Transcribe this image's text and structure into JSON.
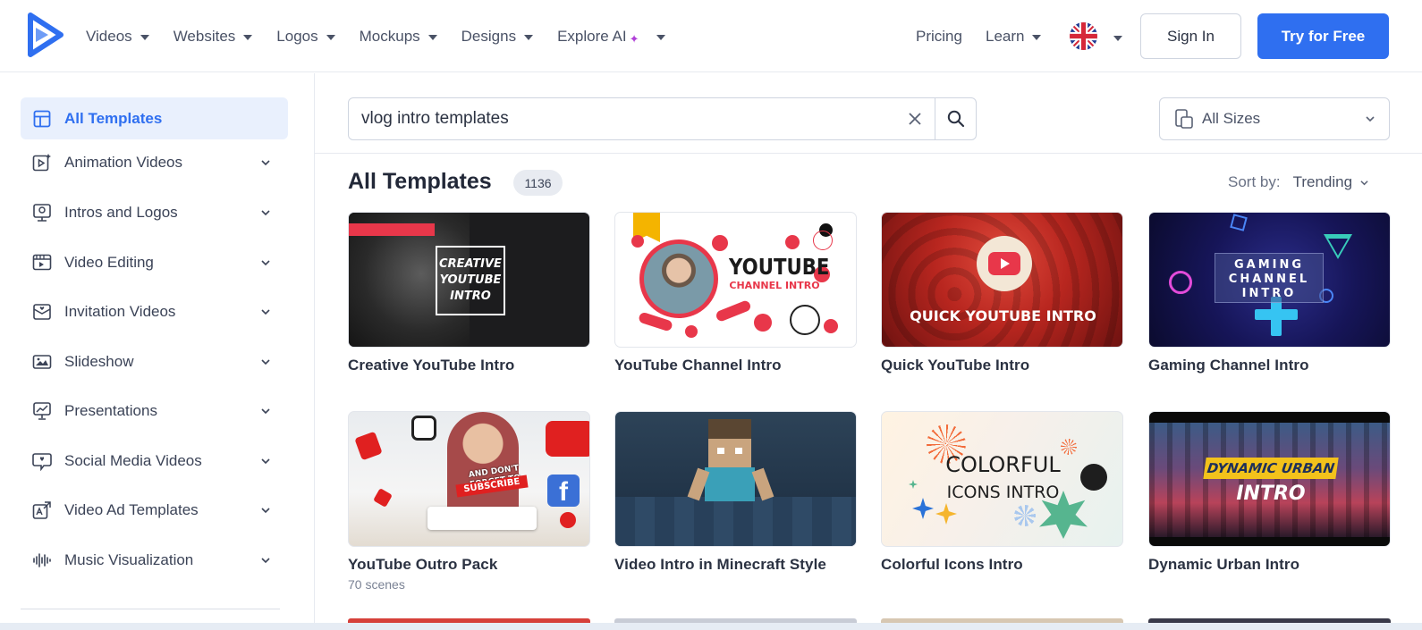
{
  "header": {
    "nav": [
      {
        "label": "Videos"
      },
      {
        "label": "Websites"
      },
      {
        "label": "Logos"
      },
      {
        "label": "Mockups"
      },
      {
        "label": "Designs"
      },
      {
        "label": "Explore AI"
      }
    ],
    "pricing": "Pricing",
    "learn": "Learn",
    "sign_in": "Sign In",
    "try_free": "Try for Free"
  },
  "sidebar": {
    "items": [
      {
        "label": "All Templates",
        "icon": "grid-layout-icon",
        "active": true
      },
      {
        "label": "Animation Videos",
        "icon": "play-sparkle-icon"
      },
      {
        "label": "Intros and Logos",
        "icon": "intro-monitor-icon"
      },
      {
        "label": "Video Editing",
        "icon": "film-edit-icon"
      },
      {
        "label": "Invitation Videos",
        "icon": "invitation-icon"
      },
      {
        "label": "Slideshow",
        "icon": "slideshow-icon"
      },
      {
        "label": "Presentations",
        "icon": "presentation-icon"
      },
      {
        "label": "Social Media Videos",
        "icon": "social-heart-icon"
      },
      {
        "label": "Video Ad Templates",
        "icon": "ad-icon"
      },
      {
        "label": "Music Visualization",
        "icon": "waveform-icon"
      }
    ]
  },
  "search": {
    "value": "vlog intro templates"
  },
  "sizes": {
    "label": "All Sizes"
  },
  "main": {
    "title": "All Templates",
    "count": "1136",
    "sort_label": "Sort by:",
    "sort_value": "Trending"
  },
  "cards": [
    {
      "title": "Creative YouTube Intro",
      "thumb_text": [
        "CREATIVE",
        "YOUTUBE",
        "INTRO"
      ]
    },
    {
      "title": "YouTube Channel Intro",
      "thumb_text": [
        "YOUTUBE",
        "CHANNEL INTRO"
      ]
    },
    {
      "title": "Quick YouTube Intro",
      "thumb_text": [
        "QUICK YOUTUBE INTRO"
      ]
    },
    {
      "title": "Gaming Channel Intro",
      "thumb_text": [
        "GAMING",
        "CHANNEL",
        "INTRO"
      ]
    },
    {
      "title": "YouTube Outro Pack",
      "subtitle": "70 scenes",
      "thumb_text": [
        "AND DON'T FORGET TO",
        "SUBSCRIBE"
      ]
    },
    {
      "title": "Video Intro in Minecraft Style"
    },
    {
      "title": "Colorful Icons Intro",
      "thumb_text": [
        "COLORFUL",
        "ICONS INTRO"
      ]
    },
    {
      "title": "Dynamic Urban Intro",
      "thumb_text": [
        "DYNAMIC URBAN",
        "INTRO"
      ]
    }
  ],
  "colors": {
    "accent": "#2f6ff0",
    "active_bg": "#e9f0fd",
    "text": "#2b3242"
  }
}
